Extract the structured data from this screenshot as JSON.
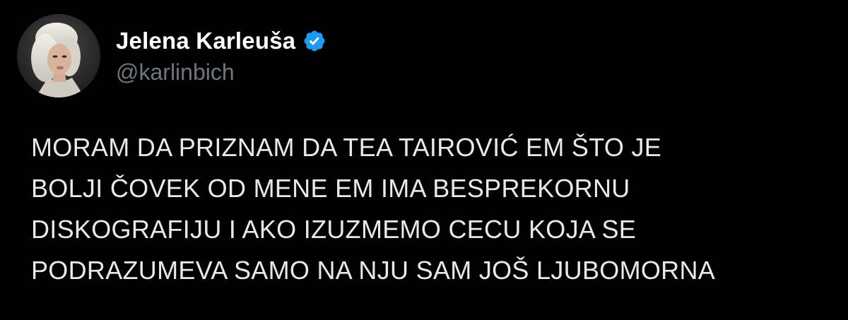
{
  "author": {
    "display_name": "Jelena Karleuša",
    "handle": "@karlinbich",
    "verified": true,
    "avatar_icon": "profile-photo",
    "verified_icon": "verified-badge-icon"
  },
  "tweet": {
    "lines": [
      "MORAM DA PRIZNAM DA TEA TAIROVIĆ EM ŠTO JE",
      "BOLJI ČOVEK OD MENE EM IMA BESPREKORNU",
      "DISKOGRAFIJU I AKO IZUZMEMO CECU KOJA SE",
      "PODRAZUMEVA SAMO NA NJU SAM JOŠ LJUBOMORNA"
    ]
  },
  "colors": {
    "background": "#000000",
    "name": "#ffffff",
    "handle": "#71767b",
    "body_text": "#e7e9ea",
    "verified_badge": "#1d9bf0"
  }
}
